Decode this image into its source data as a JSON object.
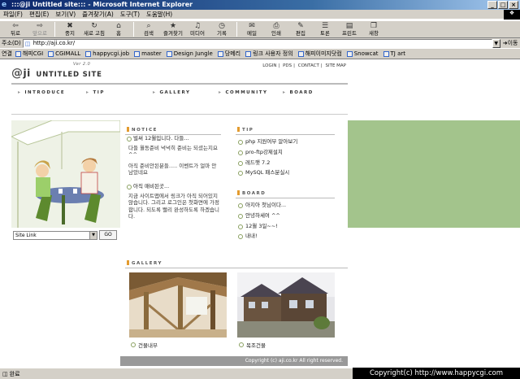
{
  "window": {
    "title": ":::@ji Untitled site::: - Microsoft Internet Explorer",
    "buttons": [
      "_",
      "□",
      "×"
    ]
  },
  "menu": [
    "파일(F)",
    "편집(E)",
    "보기(V)",
    "즐겨찾기(A)",
    "도구(T)",
    "도움말(H)"
  ],
  "toolbar": [
    {
      "label": "뒤로",
      "icon": "back-arrow-icon",
      "glyph": "⇦",
      "enabled": true
    },
    {
      "label": "앞으로",
      "icon": "forward-arrow-icon",
      "glyph": "⇨",
      "enabled": false
    },
    {
      "label": "중지",
      "icon": "stop-icon",
      "glyph": "✖",
      "enabled": true
    },
    {
      "label": "새로 고침",
      "icon": "refresh-icon",
      "glyph": "↻",
      "enabled": true
    },
    {
      "label": "홈",
      "icon": "home-icon",
      "glyph": "⌂",
      "enabled": true
    },
    {
      "label": "검색",
      "icon": "search-icon",
      "glyph": "⌕",
      "enabled": true
    },
    {
      "label": "즐겨찾기",
      "icon": "favorites-icon",
      "glyph": "★",
      "enabled": true
    },
    {
      "label": "미디어",
      "icon": "media-icon",
      "glyph": "♫",
      "enabled": true
    },
    {
      "label": "기록",
      "icon": "history-icon",
      "glyph": "◷",
      "enabled": true
    },
    {
      "label": "메일",
      "icon": "mail-icon",
      "glyph": "✉",
      "enabled": true
    },
    {
      "label": "인쇄",
      "icon": "print-icon",
      "glyph": "⎙",
      "enabled": true
    },
    {
      "label": "편집",
      "icon": "edit-icon",
      "glyph": "✎",
      "enabled": true
    },
    {
      "label": "토론",
      "icon": "discuss-icon",
      "glyph": "☰",
      "enabled": true
    },
    {
      "label": "프린트",
      "icon": "printer-icon",
      "glyph": "▤",
      "enabled": true
    },
    {
      "label": "새창",
      "icon": "new-window-icon",
      "glyph": "❐",
      "enabled": true
    }
  ],
  "address": {
    "label": "주소(D)",
    "url": "http://aji.co.kr/",
    "go": "이동"
  },
  "links": {
    "label": "연결",
    "items": [
      "해피CGI",
      "CGIMALL",
      "happycgi.job",
      "master",
      "Design Jungle",
      "당메리",
      "링크 사용자 정의",
      "해피이미지닷컴",
      "Snowcat",
      "TJ art"
    ]
  },
  "site": {
    "logo_at": "@",
    "logo_ji": "ji",
    "logo_name": "UNTITLED SITE",
    "version": "Ver 2.0",
    "toplinks": [
      "LOGIN",
      "PDS",
      "CONTACT",
      "SITE MAP"
    ],
    "nav": [
      "INTRODUCE",
      "TIP",
      "GALLERY",
      "COMMUNITY",
      "BOARD"
    ],
    "notice": {
      "title": "NOTICE",
      "items": [
        {
          "head": "벌써 12월입니다. 다들...",
          "body": "다들 월동준비 넉넉히 준비는 되셨는지요 ^^"
        },
        {
          "head": "",
          "body": "아직 준비안된분들..... 이벤트가 얼마 안남았네요"
        },
        {
          "head": "아직 매비된곳...",
          "body": "지금 사이트맵에서 링크가 아직 되어있지 않습니다. 그리고 로그인은 첫화면에 가정합니다. 되도록 빨리 완성하도록 하겠습니다."
        }
      ]
    },
    "tip": {
      "title": "TIP",
      "items": [
        "php 지원여부 알아보기",
        "pro-ftp강제설치",
        "레드햇 7.2",
        "MySQL 패스분실시"
      ]
    },
    "board": {
      "title": "BOARD",
      "items": [
        "아지아 첫님이다...",
        "안녕하세여 ^^",
        "12월 3일~~!",
        "내내!"
      ]
    },
    "sitelink": {
      "value": "Site Link",
      "go": "GO"
    },
    "gallery": {
      "title": "GALLERY",
      "items": [
        {
          "caption": "건물내부"
        },
        {
          "caption": "목조건물"
        }
      ]
    },
    "footer": "Copyright (c) aji.co.kr  All right reserved."
  },
  "status": {
    "text": "완료",
    "watermark": "Copyright(c) http://www.happycgi.com"
  }
}
